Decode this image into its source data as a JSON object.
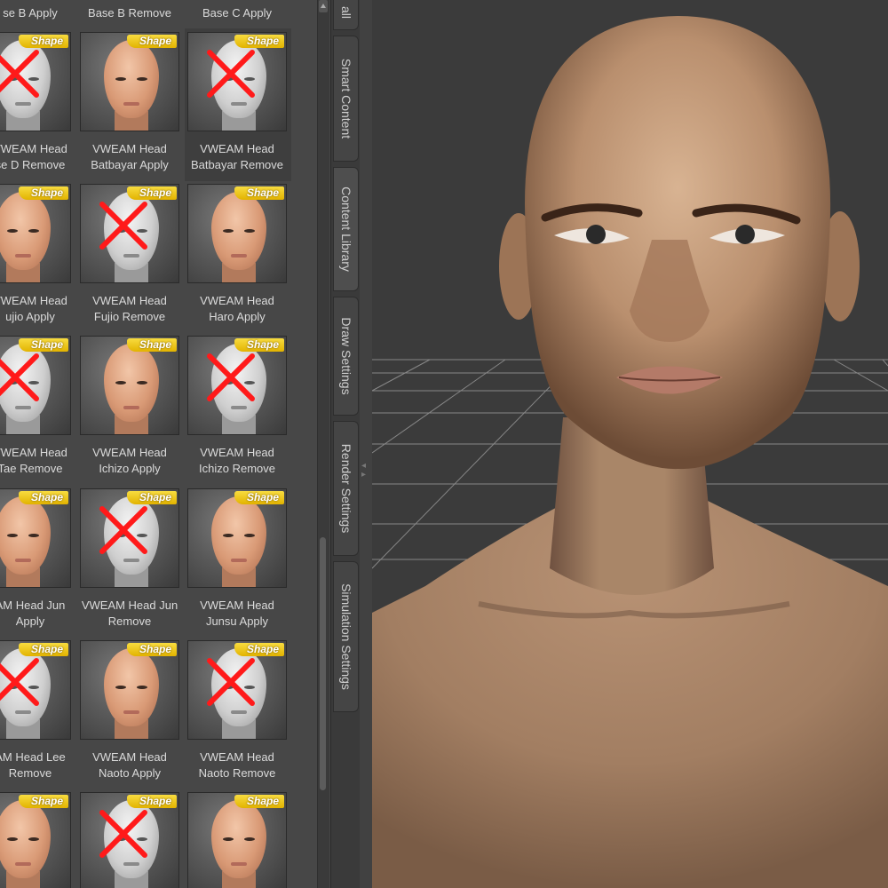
{
  "library": {
    "header_row": [
      "se B Apply",
      "Base B Remove",
      "Base C Apply"
    ],
    "badge": "Shape",
    "rows": [
      {
        "items": [
          {
            "label1": "VWEAM Head",
            "label2": "se D Remove",
            "x": true
          },
          {
            "label1": "VWEAM Head",
            "label2": "Batbayar Apply",
            "x": false
          },
          {
            "label1": "VWEAM Head",
            "label2": "Batbayar Remove",
            "x": true
          }
        ]
      },
      {
        "items": [
          {
            "label1": "VWEAM Head",
            "label2": "ujio Apply",
            "x": false
          },
          {
            "label1": "VWEAM Head",
            "label2": "Fujio Remove",
            "x": true
          },
          {
            "label1": "VWEAM Head",
            "label2": "Haro Apply",
            "x": false
          }
        ]
      },
      {
        "items": [
          {
            "label1": "VWEAM Head",
            "label2": "Tae Remove",
            "x": true
          },
          {
            "label1": "VWEAM Head",
            "label2": "Ichizo Apply",
            "x": false
          },
          {
            "label1": "VWEAM Head",
            "label2": "Ichizo Remove",
            "x": true
          }
        ]
      },
      {
        "items": [
          {
            "label1": "AM Head Jun",
            "label2": "Apply",
            "x": false
          },
          {
            "label1": "VWEAM Head Jun",
            "label2": "Remove",
            "x": true
          },
          {
            "label1": "VWEAM Head",
            "label2": "Junsu Apply",
            "x": false
          }
        ]
      },
      {
        "items": [
          {
            "label1": "AM Head Lee",
            "label2": "Remove",
            "x": true
          },
          {
            "label1": "VWEAM Head",
            "label2": "Naoto Apply",
            "x": false
          },
          {
            "label1": "VWEAM Head",
            "label2": "Naoto Remove",
            "x": true
          }
        ]
      },
      {
        "items": [
          {
            "label1": "",
            "label2": "",
            "x": false
          },
          {
            "label1": "",
            "label2": "",
            "x": true
          },
          {
            "label1": "",
            "label2": "",
            "x": false
          }
        ]
      }
    ]
  },
  "tabs": {
    "top_partial": "all",
    "smart_content": "Smart Content",
    "content_library": "Content Library",
    "draw_settings": "Draw Settings",
    "render_settings": "Render Settings",
    "simulation_settings": "Simulation Settings"
  },
  "colors": {
    "panel_bg": "#474747",
    "badge": "#f2c200",
    "remove_mark": "#ff1a1a"
  }
}
